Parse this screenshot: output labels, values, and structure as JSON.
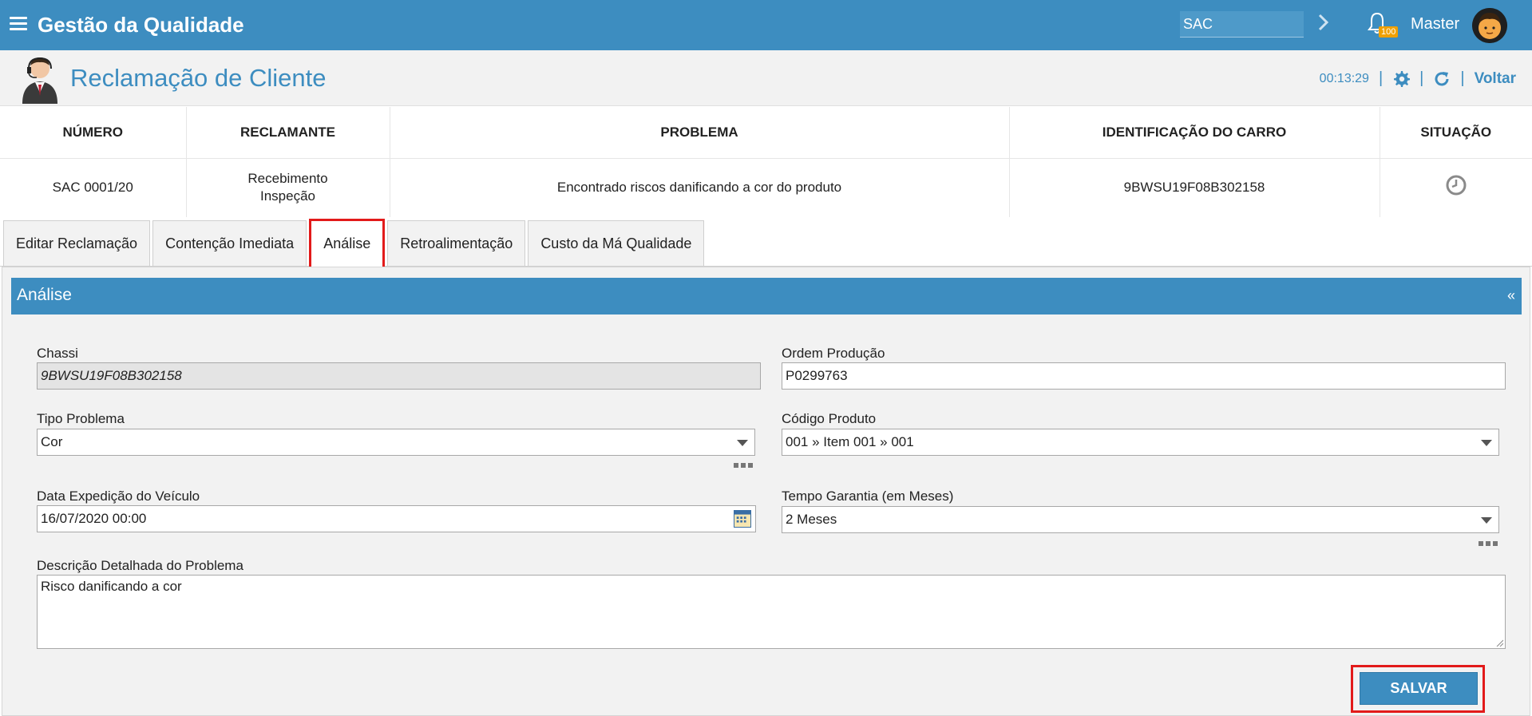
{
  "app": {
    "title": "Gestão da Qualidade"
  },
  "topbar": {
    "search_value": "SAC",
    "notification_count": "100",
    "user_name": "Master"
  },
  "page": {
    "title": "Reclamação de Cliente",
    "timer": "00:13:29",
    "back_label": "Voltar"
  },
  "summary": {
    "headers": [
      "NÚMERO",
      "RECLAMANTE",
      "PROBLEMA",
      "IDENTIFICAÇÃO DO CARRO",
      "SITUAÇÃO"
    ],
    "row": {
      "numero": "SAC 0001/20",
      "reclamante_line1": "Recebimento",
      "reclamante_line2": "Inspeção",
      "problema": "Encontrado riscos danificando a cor do produto",
      "carro": "9BWSU19F08B302158",
      "situacao_icon": "clock-icon"
    }
  },
  "tabs": [
    {
      "label": "Editar Reclamação",
      "active": false
    },
    {
      "label": "Contenção Imediata",
      "active": false
    },
    {
      "label": "Análise",
      "active": true
    },
    {
      "label": "Retroalimentação",
      "active": false
    },
    {
      "label": "Custo da Má Qualidade",
      "active": false
    }
  ],
  "panel": {
    "title": "Análise",
    "collapse_label": "«",
    "fields": {
      "chassi": {
        "label": "Chassi",
        "value": "9BWSU19F08B302158"
      },
      "ordem_producao": {
        "label": "Ordem Produção",
        "value": "P0299763"
      },
      "tipo_problema": {
        "label": "Tipo Problema",
        "value": "Cor"
      },
      "codigo_produto": {
        "label": "Código Produto",
        "value": "001 » Item 001 » 001"
      },
      "data_expedicao": {
        "label": "Data Expedição do Veículo",
        "value": "16/07/2020 00:00"
      },
      "tempo_garantia": {
        "label": "Tempo Garantia (em Meses)",
        "value": "2 Meses"
      },
      "descricao": {
        "label": "Descrição Detalhada do Problema",
        "value": "Risco danificando a cor"
      }
    },
    "save_label": "SALVAR"
  },
  "colors": {
    "primary": "#3d8dc0",
    "highlight": "#e21a1a",
    "badge": "#f0a000"
  }
}
